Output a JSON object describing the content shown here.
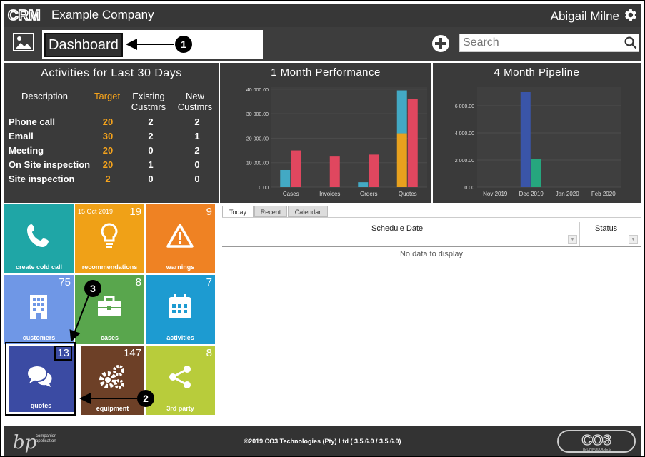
{
  "header": {
    "logo_text": "CRM",
    "company": "Example Company",
    "user": "Abigail Milne"
  },
  "toolbar": {
    "title": "Dashboard",
    "search_placeholder": "Search"
  },
  "activities": {
    "title": "Activities for Last 30 Days",
    "columns": [
      "Description",
      "Target",
      "Existing Custmrs",
      "New Custmrs"
    ],
    "col_existing_1": "Existing",
    "col_existing_2": "Custmrs",
    "col_new_1": "New",
    "col_new_2": "Custmrs",
    "rows": [
      {
        "desc": "Phone call",
        "target": "20",
        "existing": "2",
        "new": "2"
      },
      {
        "desc": "Email",
        "target": "30",
        "existing": "2",
        "new": "1"
      },
      {
        "desc": "Meeting",
        "target": "20",
        "existing": "0",
        "new": "2"
      },
      {
        "desc": "On Site inspection",
        "target": "20",
        "existing": "1",
        "new": "0"
      },
      {
        "desc": "Site inspection",
        "target": "2",
        "existing": "0",
        "new": "0"
      }
    ]
  },
  "chart_data": [
    {
      "type": "bar",
      "title": "1 Month Performance",
      "categories": [
        "Cases",
        "Invoices",
        "Orders",
        "Quotes"
      ],
      "ylim": [
        0,
        40000
      ],
      "ytick_labels": [
        "0.00",
        "10 000.00",
        "20 000.00",
        "30 000.00",
        "40 000.00"
      ],
      "yticks": [
        0,
        10000,
        20000,
        30000,
        40000
      ],
      "stacked": true,
      "series": [
        {
          "values": [
            7000,
            0,
            2000,
            39500
          ],
          "stack": [
            [
              0,
              7000
            ],
            [
              0,
              0
            ],
            [
              0,
              2000
            ],
            [
              0,
              22000
            ]
          ],
          "color_bottom": "#e8a11e",
          "color": "#43a9c4"
        },
        {
          "values": [
            15000,
            12500,
            13300,
            36000
          ],
          "color": "#e0475f"
        }
      ],
      "quote_bottom": 22000,
      "colors": {
        "blue": "#43a9c4",
        "orange": "#e8a11e",
        "red": "#e0475f"
      }
    },
    {
      "type": "bar",
      "title": "4 Month Pipeline",
      "categories": [
        "Nov 2019",
        "Dec 2019",
        "Jan 2020",
        "Feb 2020"
      ],
      "ylim": [
        0,
        7000
      ],
      "ytick_labels": [
        "0.00",
        "2 000.00",
        "4 000.00",
        "6 000.00"
      ],
      "yticks": [
        0,
        2000,
        4000,
        6000
      ],
      "series": [
        {
          "values": [
            0,
            7000,
            0,
            0
          ],
          "color": "#3a55a8"
        },
        {
          "values": [
            0,
            2100,
            0,
            0
          ],
          "color": "#26a67e"
        }
      ]
    }
  ],
  "tiles": [
    {
      "label": "create cold call",
      "count": "",
      "date": "",
      "color": "#1fa6a6",
      "icon": "phone-icon"
    },
    {
      "label": "recommendations",
      "count": "19",
      "date": "15 Oct 2019",
      "color": "#f0a117",
      "icon": "lightbulb-icon"
    },
    {
      "label": "warnings",
      "count": "9",
      "date": "",
      "color": "#ef8223",
      "icon": "warning-icon"
    },
    {
      "label": "customers",
      "count": "75",
      "date": "",
      "color": "#6f97e6",
      "icon": "building-icon"
    },
    {
      "label": "cases",
      "count": "8",
      "date": "",
      "color": "#59a64d",
      "icon": "briefcase-icon"
    },
    {
      "label": "activities",
      "count": "7",
      "date": "",
      "color": "#1d9bd1",
      "icon": "calendar-icon"
    },
    {
      "label": "quotes",
      "count": "13",
      "date": "",
      "color": "#3b4ba3",
      "icon": "chat-icon"
    },
    {
      "label": "equipment",
      "count": "147",
      "date": "",
      "color": "#6d4027",
      "icon": "gears-icon"
    },
    {
      "label": "3rd party",
      "count": "8",
      "date": "",
      "color": "#b8cc3b",
      "icon": "share-icon"
    }
  ],
  "schedule": {
    "tabs": [
      "Today",
      "Recent",
      "Calendar"
    ],
    "col_date": "Schedule Date",
    "col_status": "Status",
    "empty": "No data to display"
  },
  "footer": {
    "app_logo": "bp",
    "app_tag_1": "companion",
    "app_tag_2": "application",
    "copyright": "©2019 CO3 Technologies (Pty) Ltd ( 3.5.6.0 / 3.5.6.0)",
    "brand": "CO3",
    "brand_sub": "TECHNOLOGIES"
  },
  "callouts": [
    "1",
    "2",
    "3"
  ]
}
